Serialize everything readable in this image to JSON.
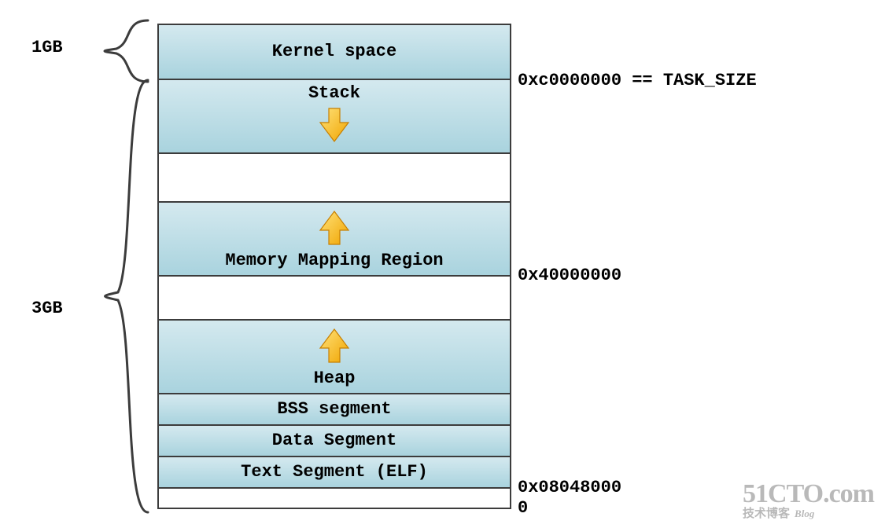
{
  "left": {
    "label1gb": "1GB",
    "label3gb": "3GB"
  },
  "rows": {
    "kernel": "Kernel space",
    "stack": "Stack",
    "mmap": "Memory Mapping Region",
    "heap": "Heap",
    "bss": "BSS segment",
    "data": "Data Segment",
    "text": "Text Segment (ELF)"
  },
  "right": {
    "kernel_boundary": "0xc0000000 == TASK_SIZE",
    "mmap_addr": "0x40000000",
    "text_addr": "0x08048000",
    "zero": "0"
  },
  "watermark": {
    "main": "51CTO.com",
    "sub": "技术博客",
    "blog": "Blog"
  }
}
